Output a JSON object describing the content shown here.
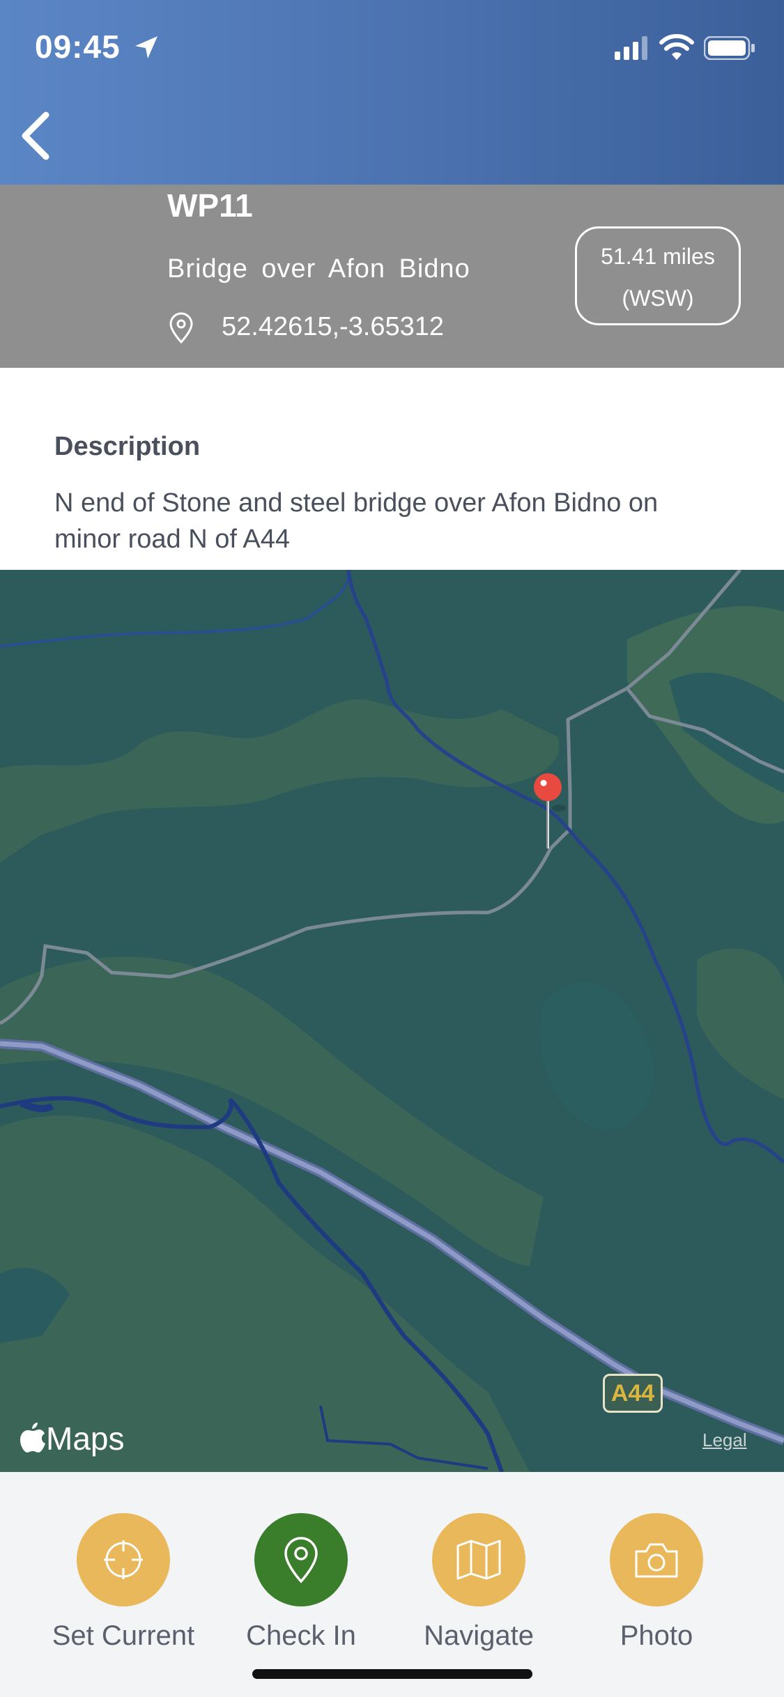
{
  "status_bar": {
    "time": "09:45",
    "icons": [
      "location-arrow-icon",
      "cellular-signal-icon",
      "wifi-icon",
      "battery-icon"
    ]
  },
  "nav": {
    "back_icon": "chevron-left-icon"
  },
  "waypoint": {
    "id": "WP11",
    "name": "Bridge over Afon Bidno",
    "coordinates": "52.42615,-3.65312",
    "distance": "51.41 miles",
    "direction": "(WSW)"
  },
  "description": {
    "label": "Description",
    "text": "N end of Stone and steel bridge over Afon Bidno on minor road N of A44"
  },
  "map": {
    "road_label": "A44",
    "attribution": "Maps",
    "legal_link": "Legal"
  },
  "actions": [
    {
      "label": "Set Current",
      "icon": "crosshair-icon",
      "color": "#e9b85a"
    },
    {
      "label": "Check In",
      "icon": "map-pin-icon",
      "color": "#3a7d2a"
    },
    {
      "label": "Navigate",
      "icon": "map-icon",
      "color": "#e9b85a"
    },
    {
      "label": "Photo",
      "icon": "camera-icon",
      "color": "#e9b85a"
    }
  ],
  "colors": {
    "header_blue": "#4b72af",
    "header_gray": "#8f8f8f",
    "map_green": "#2d5a5b",
    "accent_yellow": "#e9b85a",
    "accent_green": "#3a7d2a",
    "pin_red": "#e84a3f"
  }
}
